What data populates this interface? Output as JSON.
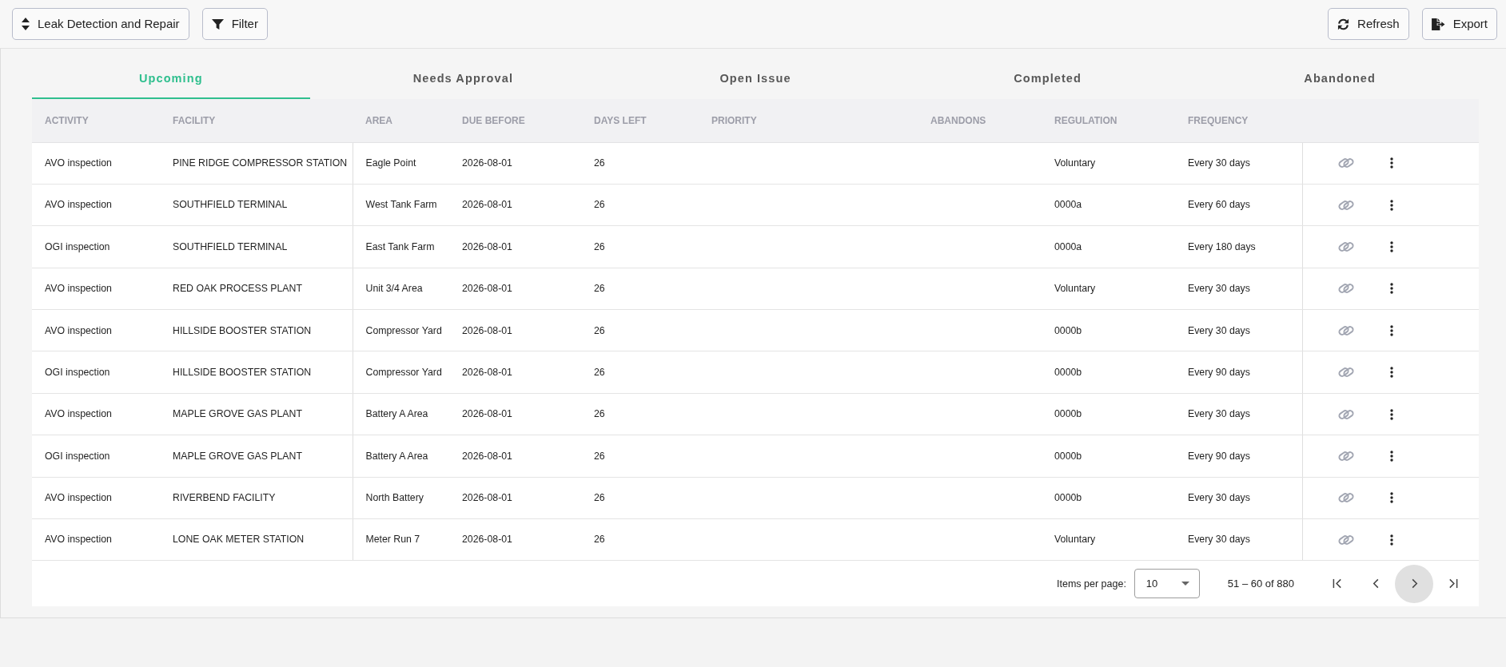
{
  "toolbar": {
    "left_buttons": [
      {
        "kind": "sort",
        "label": "Leak Detection and Repair"
      },
      {
        "kind": "filter",
        "label": "Filter"
      }
    ],
    "right_buttons": [
      {
        "kind": "refresh",
        "label": "Refresh"
      },
      {
        "kind": "export",
        "label": "Export"
      }
    ]
  },
  "tabs": [
    {
      "label": "Upcoming",
      "selected": true
    },
    {
      "label": "Needs Approval",
      "selected": false
    },
    {
      "label": "Open Issue",
      "selected": false
    },
    {
      "label": "Completed",
      "selected": false
    },
    {
      "label": "Abandoned",
      "selected": false
    }
  ],
  "table": {
    "columns": [
      "ACTIVITY",
      "FACILITY",
      "AREA",
      "DUE BEFORE",
      "DAYS LEFT",
      "PRIORITY",
      "ABANDONS",
      "REGULATION",
      "FREQUENCY"
    ],
    "rows": [
      {
        "activity": "AVO inspection",
        "facility": "PINE RIDGE COMPRESSOR STATION",
        "area": "Eagle Point",
        "due_before": "2026-08-01",
        "days_left": "26",
        "regulation": "Voluntary",
        "frequency": "Every 30 days"
      },
      {
        "activity": "AVO inspection",
        "facility": "SOUTHFIELD TERMINAL",
        "area": "West Tank Farm",
        "due_before": "2026-08-01",
        "days_left": "26",
        "regulation": "0000a",
        "frequency": "Every 60 days"
      },
      {
        "activity": "OGI inspection",
        "facility": "SOUTHFIELD TERMINAL",
        "area": "East Tank Farm",
        "due_before": "2026-08-01",
        "days_left": "26",
        "regulation": "0000a",
        "frequency": "Every 180 days"
      },
      {
        "activity": "AVO inspection",
        "facility": "RED OAK PROCESS PLANT",
        "area": "Unit 3/4 Area",
        "due_before": "2026-08-01",
        "days_left": "26",
        "regulation": "Voluntary",
        "frequency": "Every 30 days"
      },
      {
        "activity": "AVO inspection",
        "facility": "HILLSIDE BOOSTER STATION",
        "area": "Compressor Yard",
        "due_before": "2026-08-01",
        "days_left": "26",
        "regulation": "0000b",
        "frequency": "Every 30 days"
      },
      {
        "activity": "OGI inspection",
        "facility": "HILLSIDE BOOSTER STATION",
        "area": "Compressor Yard",
        "due_before": "2026-08-01",
        "days_left": "26",
        "regulation": "0000b",
        "frequency": "Every 90 days"
      },
      {
        "activity": "AVO inspection",
        "facility": "MAPLE GROVE GAS PLANT",
        "area": "Battery A Area",
        "due_before": "2026-08-01",
        "days_left": "26",
        "regulation": "0000b",
        "frequency": "Every 30 days"
      },
      {
        "activity": "OGI inspection",
        "facility": "MAPLE GROVE GAS PLANT",
        "area": "Battery A Area",
        "due_before": "2026-08-01",
        "days_left": "26",
        "regulation": "0000b",
        "frequency": "Every 90 days"
      },
      {
        "activity": "AVO inspection",
        "facility": "RIVERBEND FACILITY",
        "area": "North Battery",
        "due_before": "2026-08-01",
        "days_left": "26",
        "regulation": "0000b",
        "frequency": "Every 30 days"
      },
      {
        "activity": "AVO inspection",
        "facility": "LONE OAK METER STATION",
        "area": "Meter Run 7",
        "due_before": "2026-08-01",
        "days_left": "26",
        "regulation": "Voluntary",
        "frequency": "Every 30 days"
      }
    ]
  },
  "pagination": {
    "items_per_page_label": "Items per page:",
    "page_size": "10",
    "range": "51 – 60 of 880",
    "buttons": [
      {
        "kind": "first",
        "highlighted": false
      },
      {
        "kind": "previous",
        "highlighted": false
      },
      {
        "kind": "next",
        "highlighted": true
      },
      {
        "kind": "last",
        "highlighted": false
      }
    ]
  }
}
